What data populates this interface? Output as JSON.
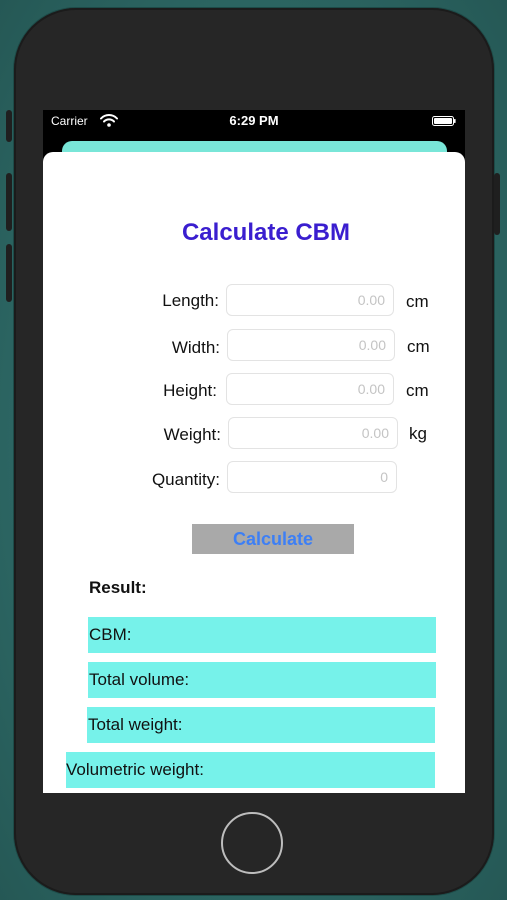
{
  "status_bar": {
    "carrier": "Carrier",
    "time": "6:29 PM"
  },
  "form": {
    "title": "Calculate CBM",
    "fields": [
      {
        "label": "Length:",
        "placeholder": "0.00",
        "value": "",
        "unit": "cm"
      },
      {
        "label": "Width:",
        "placeholder": "0.00",
        "value": "",
        "unit": "cm"
      },
      {
        "label": "Height:",
        "placeholder": "0.00",
        "value": "",
        "unit": "cm"
      },
      {
        "label": "Weight:",
        "placeholder": "0.00",
        "value": "",
        "unit": "kg"
      },
      {
        "label": "Quantity:",
        "placeholder": "0",
        "value": "",
        "unit": ""
      }
    ],
    "calculate_label": "Calculate"
  },
  "results": {
    "heading": "Result:",
    "rows": [
      {
        "label": "CBM:"
      },
      {
        "label": "Total volume:"
      },
      {
        "label": "Total weight:"
      },
      {
        "label": "Volumetric weight:"
      }
    ]
  },
  "colors": {
    "title": "#3a1ecf",
    "button_text": "#3d7ff5",
    "button_bg": "#a9a9a9",
    "result_bg": "#76f2ea",
    "header_strip": "#79e6d8"
  }
}
